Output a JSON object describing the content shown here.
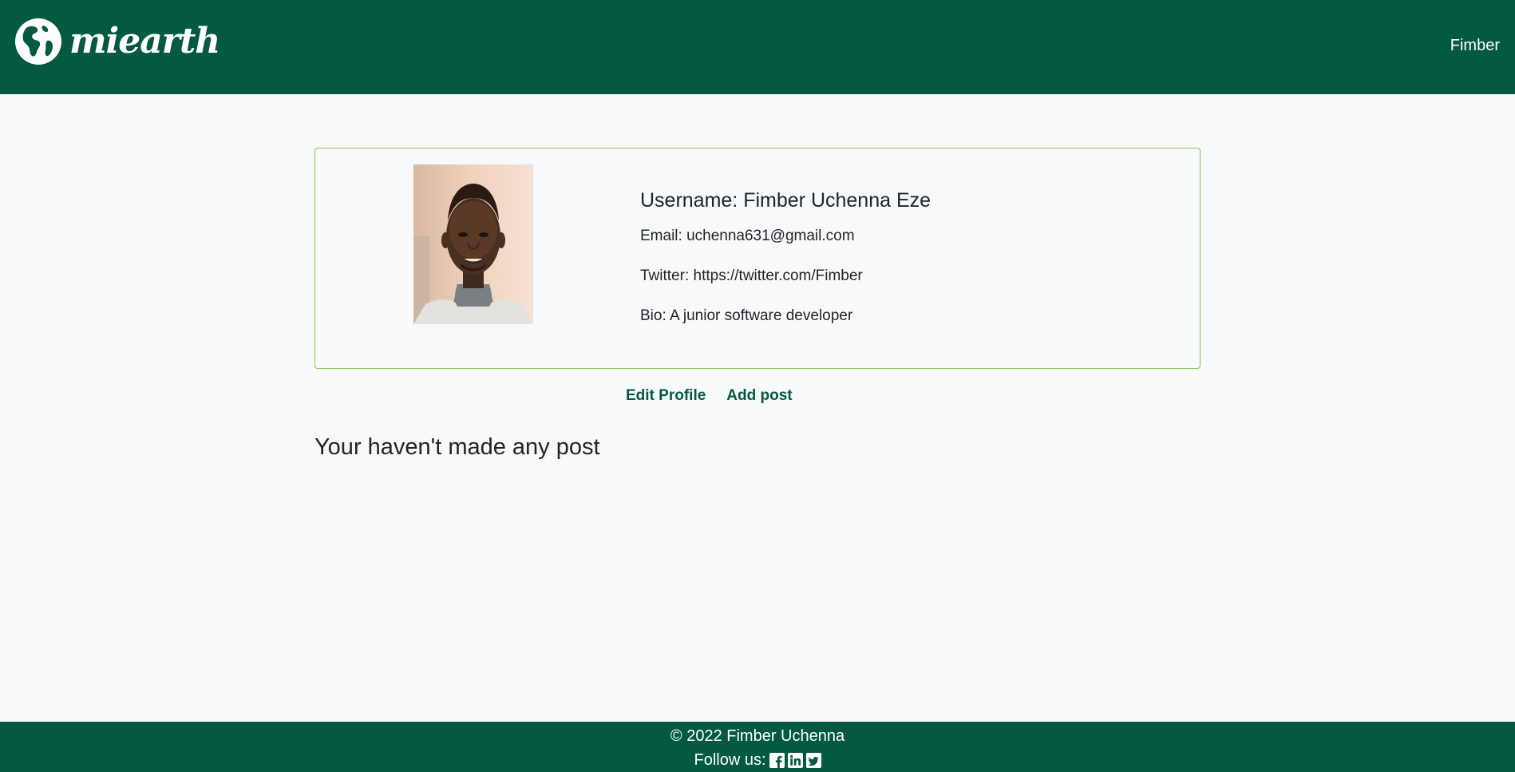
{
  "header": {
    "brand": "miearth",
    "user_link": "Fimber"
  },
  "profile": {
    "username": "Username: Fimber Uchenna Eze",
    "email": "Email: uchenna631@gmail.com",
    "twitter": "Twitter: https://twitter.com/Fimber",
    "bio": "Bio: A junior software developer"
  },
  "actions": {
    "edit_profile": "Edit Profile",
    "add_post": "Add post"
  },
  "posts": {
    "empty_message": "Your haven't made any post"
  },
  "footer": {
    "copyright": "© 2022 Fimber Uchenna",
    "follow_label": "Follow us:",
    "social": [
      "facebook-icon",
      "linkedin-icon",
      "twitter-icon"
    ]
  },
  "colors": {
    "primary": "#045941",
    "background": "#f8f9fa",
    "card_border": "#8bc34a",
    "text": "#212529"
  }
}
